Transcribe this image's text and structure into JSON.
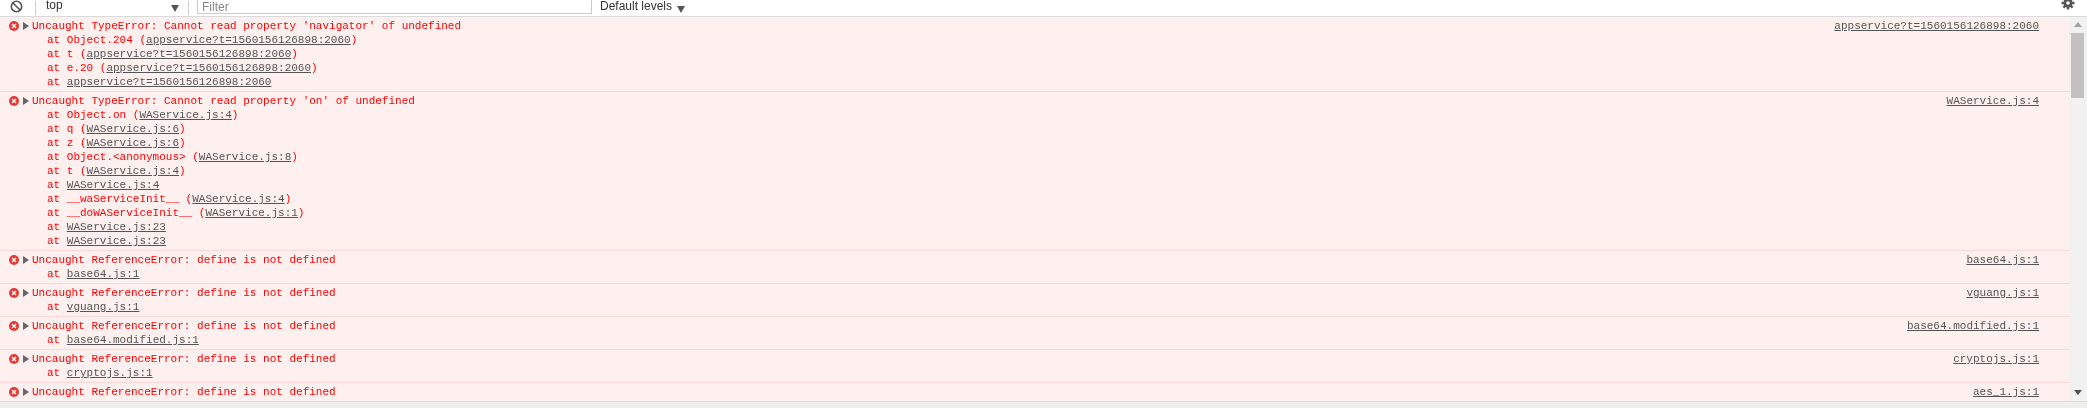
{
  "toolbar": {
    "context": "top",
    "filter": {
      "placeholder": "Filter"
    },
    "levels": "Default levels"
  },
  "messages": [
    {
      "kind": "error",
      "expanded": false,
      "text": "Uncaught TypeError: Cannot read property 'navigator' of undefined",
      "source": "appservice?t=1560156126898:2060",
      "frames": [
        {
          "before": "at Object.204 (",
          "link": "appservice?t=1560156126898:2060",
          "after": ")"
        },
        {
          "before": "at t (",
          "link": "appservice?t=1560156126898:2060",
          "after": ")"
        },
        {
          "before": "at e.20 (",
          "link": "appservice?t=1560156126898:2060",
          "after": ")"
        },
        {
          "before": "at ",
          "link": "appservice?t=1560156126898:2060"
        }
      ]
    },
    {
      "kind": "error",
      "expanded": false,
      "text": "Uncaught TypeError: Cannot read property 'on' of undefined",
      "source": "WAService.js:4",
      "frames": [
        {
          "before": "at Object.on (",
          "link": "WAService.js:4",
          "after": ")"
        },
        {
          "before": "at q (",
          "link": "WAService.js:6",
          "after": ")"
        },
        {
          "before": "at z (",
          "link": "WAService.js:6",
          "after": ")"
        },
        {
          "before": "at Object.<anonymous> (",
          "link": "WAService.js:8",
          "after": ")"
        },
        {
          "before": "at t (",
          "link": "WAService.js:4",
          "after": ")"
        },
        {
          "before": "at ",
          "link": "WAService.js:4"
        },
        {
          "before": "at __waServiceInit__ (",
          "link": "WAService.js:4",
          "after": ")"
        },
        {
          "before": "at __doWAServiceInit__ (",
          "link": "WAService.js:1",
          "after": ")"
        },
        {
          "before": "at ",
          "link": "WAService.js:23"
        },
        {
          "before": "at ",
          "link": "WAService.js:23"
        }
      ]
    },
    {
      "kind": "error",
      "expanded": false,
      "text": "Uncaught ReferenceError: define is not defined",
      "source": "base64.js:1",
      "frames": [
        {
          "before": "at ",
          "link": "base64.js:1"
        }
      ]
    },
    {
      "kind": "error",
      "expanded": false,
      "text": "Uncaught ReferenceError: define is not defined",
      "source": "vguang.js:1",
      "frames": [
        {
          "before": "at ",
          "link": "vguang.js:1"
        }
      ]
    },
    {
      "kind": "error",
      "expanded": false,
      "text": "Uncaught ReferenceError: define is not defined",
      "source": "base64.modified.js:1",
      "frames": [
        {
          "before": "at ",
          "link": "base64.modified.js:1"
        }
      ]
    },
    {
      "kind": "error",
      "expanded": false,
      "text": "Uncaught ReferenceError: define is not defined",
      "source": "cryptojs.js:1",
      "frames": [
        {
          "before": "at ",
          "link": "cryptojs.js:1"
        }
      ]
    },
    {
      "kind": "error",
      "expanded": false,
      "text": "Uncaught ReferenceError: define is not defined",
      "source": "aes_1.js:1"
    }
  ]
}
